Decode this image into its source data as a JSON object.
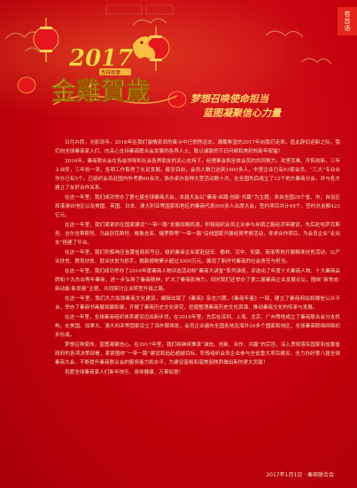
{
  "side_tab": {
    "label": "卷首语"
  },
  "banner": {
    "year": "2017",
    "small_tag": "吉祥如意",
    "title": "金雞賀歲"
  },
  "headline": {
    "line1": "梦想召唤使命担当",
    "line2": "蓝图凝聚信心力量"
  },
  "body": [
    "日月卉转，光影流年。2016年在我们激情澎湃的奋斗中已悄然远去，满载希望的2017年向我们走来。值此辞旧迎新之际，我们向全球秦商家人们、向关心支持秦商联合会发展的各界人士，致以诚挚的节日问候和美好的新年祝福！",
    "2016年，秦商联合会在各级领导和社会各界朋友的关心支持下，经理事会和全体会员的共同努力，攻坚克难、开拓创新，三年上台阶，三年创一流，各项工作取得了长足发展。截至目前，会员人数已达到1000多人，中坚企业已有63家会员，“三大”专业合作办已有5个。已组织会员赴国内外考察60余次，协办承办各种大型活动数十次，在全国先后成立了12个地方秦商分会，并与各方建立了友好合作关系。",
    "在这一年里，我们成功举办了第七届全球秦商大会，本届大会以“秦商·丝路·创新·共赢”为主题，来自全国28个省、市、自治区和港澳台地区以及美国、英国、日本、澳大利亚等国家和地区的秦商代表500多人出席大会，签约项目共计48个，签约总金额423亿元。",
    "在这一年里，我们紧紧抓住国家建设“一带一路”发展战略机遇，积极组织会员企业参与丝绸之路经济带建设，先后赴哈萨克斯坦、吉尔吉斯斯坦、乌兹别克斯坦、格鲁吉亚、俄罗斯等“一带一路”沿线国家开展经贸考察活动，寻求合作项目，为会员企业“走出去”搭建了平台。",
    "在这一年里，我们积极响应省委省政府号召，组织秦商企业家赴延安、榆林、汉中、安康、商洛等地开展精准扶贫活动，以产业扶贫、教育扶贫、就业扶贫为抓手，捐款捐物累计超过3000万元，展现了新时代秦商的社会责任与担当。",
    "在这一年里，我们成功举办了2016年度秦商人物评选活动和“秦商大讲堂”系列讲座，评选出了年度十大秦商人物、十大秦商品牌和十大杰出青年秦商，进一步弘扬了秦商精神，扩大了秦商影响力。同时我们还举办了第二届秦商企业发展论坛，围绕“新常态·新动能·新发展”主题，共同探讨企业转型升级之路。",
    "在这一年里，我们大力加强秦商文化建设，编辑出版了《秦商》杂志六期，《秦商年鉴》一部，建立了秦商网站和微信公众平台，举办了秦商书画展和摄影展，开展了秦商历史文化研究，挖掘整理秦商历史文化资源，推动秦商文化的传承与发展。",
    "在这一年里，全球秦商组织体系建设迈出新步伐，在2016年里，先后在深圳、上海、北京、广州等地成立了秦商联合会分支机构，在美国、加拿大、澳大利亚等国家设立了海外联络处，会员企业遍布全国各地及海外20多个国家和地区，全球秦商联络网络初步形成。",
    "梦想召唤使命，蓝图凝聚信心。在2017年里，我们将继续秉承“诚信、创新、合作、共赢”的宗旨，深入贯彻落实国家和省委省政府的各项决策部署，紧紧围绕“一带一路”建设和追赶超越目标，积极组织会员企业参与全省重大项目建设，全力办好第八届全球秦商大会，不断提升秦商联合会的服务能力和水平，为建设富裕和谐美丽陕西做出新的更大贡献！",
    "祝愿全球秦商家人们新年快乐、身体健康、万事如意！"
  ],
  "footer": {
    "date_text": "2017年1月1日 · 秦商联合会"
  },
  "colors": {
    "background": "#c8000e",
    "headline": "#ffd46a",
    "text": "#f6dcc0"
  }
}
